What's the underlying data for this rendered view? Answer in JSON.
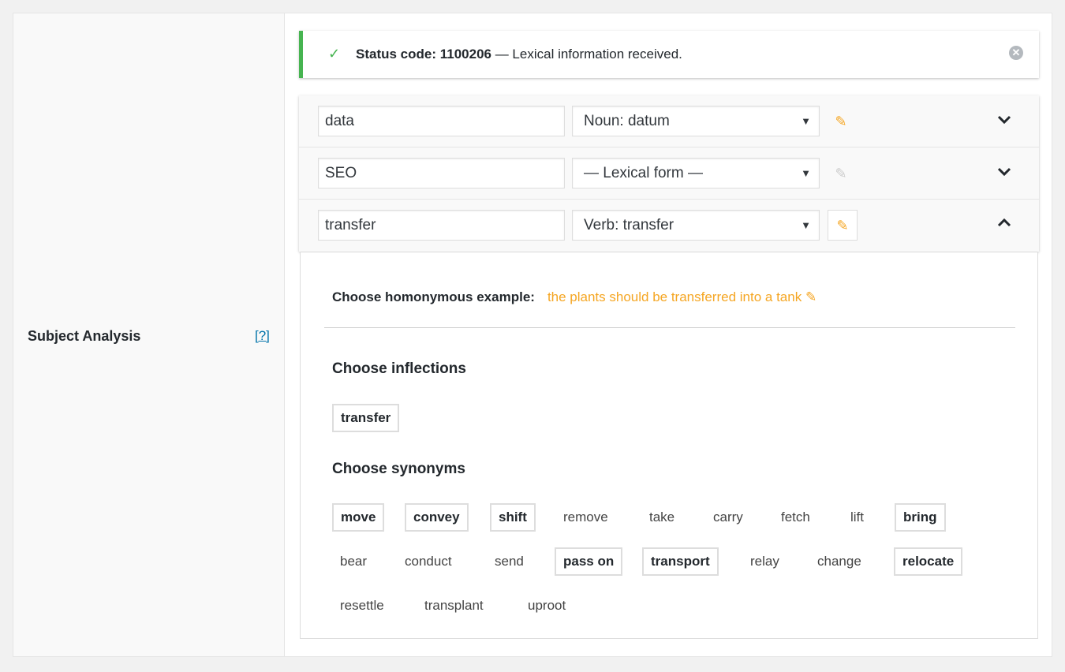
{
  "field": {
    "label": "Subject Analysis",
    "help": "[?]"
  },
  "notice": {
    "status_label": "Status code: 1100206",
    "message": " — Lexical information received.",
    "check": "✓",
    "dismiss": "✕"
  },
  "rows": [
    {
      "word": "data",
      "form": "Noun: datum",
      "expanded": false
    },
    {
      "word": "SEO",
      "form": "— Lexical form —",
      "expanded": false
    },
    {
      "word": "transfer",
      "form": "Verb: transfer",
      "expanded": true
    }
  ],
  "detail": {
    "homonym_label": "Choose homonymous example:",
    "homonym_value": "the plants should be transferred into a tank",
    "inflections_title": "Choose inflections",
    "inflections": [
      {
        "text": "transfer",
        "selected": true
      }
    ],
    "synonyms_title": "Choose synonyms",
    "synonyms": [
      {
        "text": "move",
        "selected": true
      },
      {
        "text": "convey",
        "selected": true
      },
      {
        "text": "shift",
        "selected": true
      },
      {
        "text": "remove",
        "selected": false
      },
      {
        "text": "take",
        "selected": false
      },
      {
        "text": "carry",
        "selected": false
      },
      {
        "text": "fetch",
        "selected": false
      },
      {
        "text": "lift",
        "selected": false
      },
      {
        "text": "bring",
        "selected": true
      },
      {
        "text": "bear",
        "selected": false
      },
      {
        "text": "conduct",
        "selected": false
      },
      {
        "text": "send",
        "selected": false
      },
      {
        "text": "pass on",
        "selected": true
      },
      {
        "text": "transport",
        "selected": true
      },
      {
        "text": "relay",
        "selected": false
      },
      {
        "text": "change",
        "selected": false
      },
      {
        "text": "relocate",
        "selected": true
      },
      {
        "text": "resettle",
        "selected": false
      },
      {
        "text": "transplant",
        "selected": false
      },
      {
        "text": "uproot",
        "selected": false
      }
    ]
  },
  "colors": {
    "accent": "#f5a623",
    "success": "#46b450",
    "link": "#0073aa"
  },
  "icons": {
    "edit": "pencil-icon",
    "expand": "chevron-down-icon",
    "collapse": "chevron-up-icon",
    "dismiss": "close-circle-icon",
    "success": "check-icon"
  }
}
